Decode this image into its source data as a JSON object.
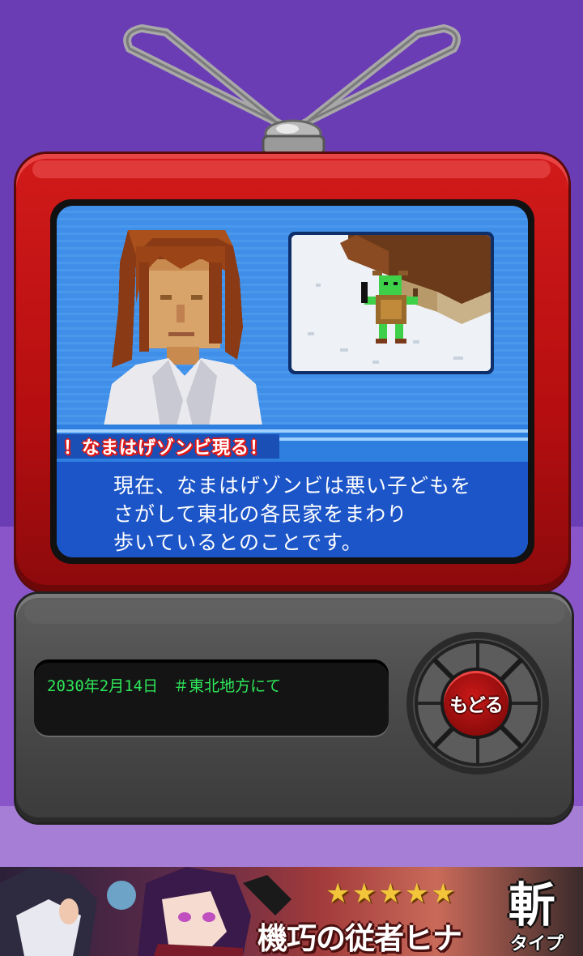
{
  "news": {
    "headline": "！なまはげゾンビ現る！",
    "caption_lines": [
      "現在、なまはげゾンビは悪い子どもを",
      "さがして東北の各民家をまわり",
      "歩いているとのことです。"
    ]
  },
  "panel": {
    "lcd_text": "2030年2月14日　＃東北地方にて",
    "back_button_label": "もどる"
  },
  "banner": {
    "stars": [
      "★",
      "★",
      "★",
      "★",
      "★"
    ],
    "title": "機巧の従者ヒナ",
    "type_kanji": "斬",
    "type_label": "タイプ"
  },
  "colors": {
    "background": "#6b3db5",
    "tv_red": "#c81414",
    "screen_blue": "#3f8fe8",
    "lcd_green": "#2ee85a"
  },
  "icons": {
    "antenna": "antenna-icon",
    "back": "back-button",
    "dpad": "dpad-icon",
    "anchor": "news-anchor-portrait",
    "zombie": "zombie-scene"
  }
}
